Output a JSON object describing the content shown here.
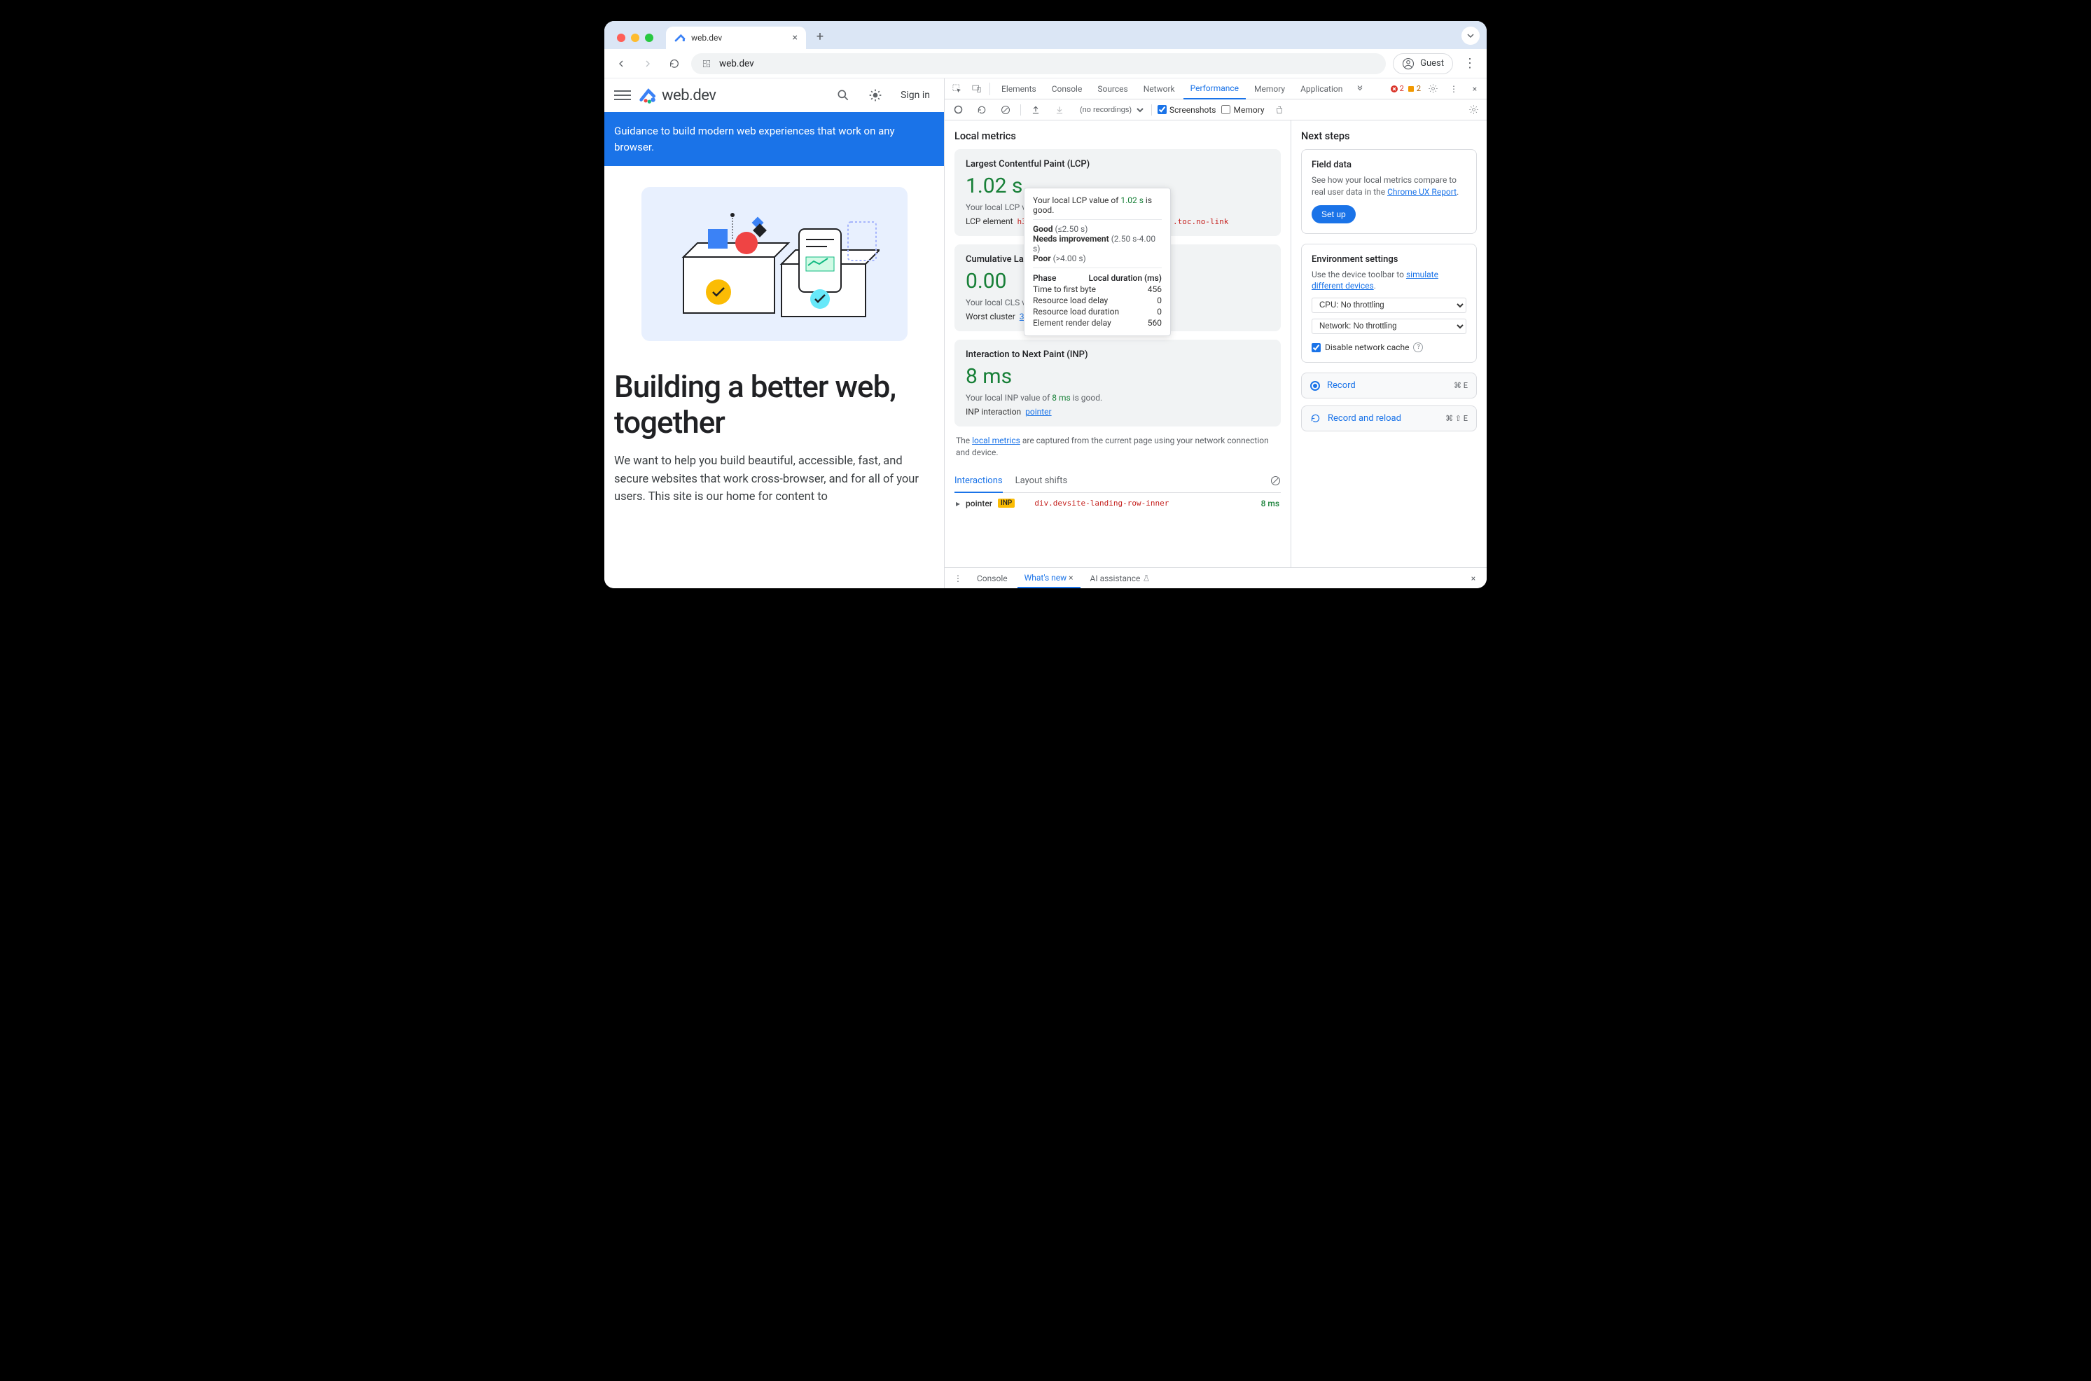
{
  "browser": {
    "tab_title": "web.dev",
    "url": "web.dev",
    "guest_label": "Guest"
  },
  "page": {
    "brand": "web.dev",
    "signin": "Sign in",
    "banner": "Guidance to build modern web experiences that work on any browser.",
    "hero_title": "Building a better web, together",
    "hero_sub": "We want to help you build beautiful, accessible, fast, and secure websites that work cross-browser, and for all of your users. This site is our home for content to"
  },
  "devtools": {
    "tabs": [
      "Elements",
      "Console",
      "Sources",
      "Network",
      "Performance",
      "Memory",
      "Application"
    ],
    "active_tab": "Performance",
    "errors": "2",
    "warnings": "2",
    "recordings_placeholder": "(no recordings)",
    "screenshots_label": "Screenshots",
    "memory_label": "Memory",
    "local_metrics_heading": "Local metrics",
    "next_steps_heading": "Next steps",
    "lcp": {
      "title": "Largest Contentful Paint (LCP)",
      "value": "1.02 s",
      "desc_prefix": "Your local LCP valu",
      "element_label": "LCP element",
      "element_path_pre": "h3#b",
      "element_path_post": ".toc.no-link"
    },
    "cls": {
      "title": "Cumulative Layo",
      "value": "0.00",
      "desc_prefix": "Your local CLS valu",
      "worst_label": "Worst cluster",
      "worst_link": "3 shifts"
    },
    "inp": {
      "title": "Interaction to Next Paint (INP)",
      "value": "8 ms",
      "desc_prefix": "Your local INP value of ",
      "desc_val": "8 ms",
      "desc_suffix": " is good.",
      "interaction_label": "INP interaction",
      "interaction_link": "pointer"
    },
    "caption_pre": "The ",
    "caption_link": "local metrics",
    "caption_post": " are captured from the current page using your network connection and device.",
    "sub_tabs": {
      "interactions": "Interactions",
      "layout_shifts": "Layout shifts"
    },
    "interaction_row": {
      "type": "pointer",
      "chip": "INP",
      "target": "div.devsite-landing-row-inner",
      "time": "8 ms"
    },
    "popover": {
      "line1_pre": "Your local LCP value of ",
      "line1_val": "1.02 s",
      "line1_post": " is good.",
      "good_label": "Good",
      "good_range": "(≤2.50 s)",
      "ni_label": "Needs improvement",
      "ni_range": "(2.50 s-4.00 s)",
      "poor_label": "Poor",
      "poor_range": "(>4.00 s)",
      "phase_hdr": "Phase",
      "dur_hdr": "Local duration (ms)",
      "phases": [
        {
          "name": "Time to first byte",
          "val": "456"
        },
        {
          "name": "Resource load delay",
          "val": "0"
        },
        {
          "name": "Resource load duration",
          "val": "0"
        },
        {
          "name": "Element render delay",
          "val": "560"
        }
      ]
    },
    "field_card": {
      "title": "Field data",
      "text_pre": "See how your local metrics compare to real user data in the ",
      "link": "Chrome UX Report",
      "setup": "Set up"
    },
    "env_card": {
      "title": "Environment settings",
      "text_pre": "Use the device toolbar to ",
      "link": "simulate different devices",
      "cpu": "CPU: No throttling",
      "network": "Network: No throttling",
      "disable_cache": "Disable network cache"
    },
    "record_label": "Record",
    "record_shortcut": "⌘ E",
    "reload_label": "Record and reload",
    "reload_shortcut": "⌘ ⇧ E",
    "drawer": {
      "console": "Console",
      "whatsnew": "What's new",
      "ai": "AI assistance"
    }
  }
}
